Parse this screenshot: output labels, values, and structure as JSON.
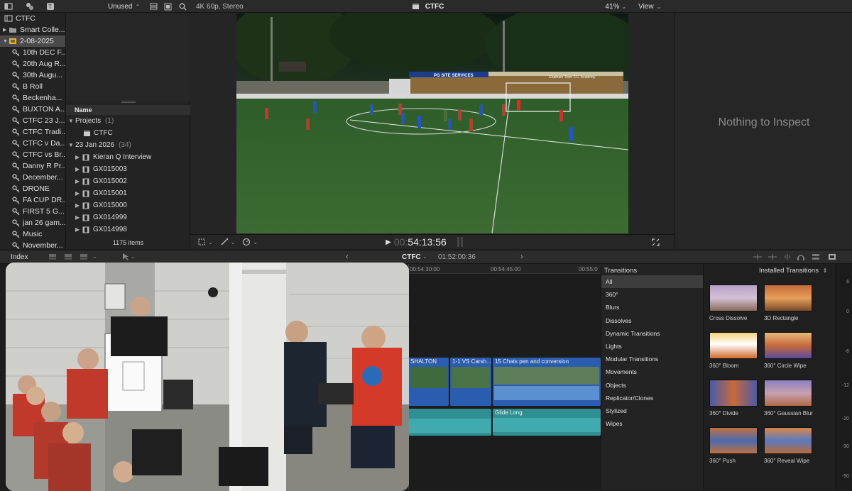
{
  "library": {
    "title": "CTFC",
    "items": [
      {
        "label": "Smart Colle...",
        "icon": "folder-icon",
        "kind": "folder"
      },
      {
        "label": "2-08-2025",
        "icon": "event-icon",
        "kind": "event",
        "selected": true
      },
      {
        "label": "10th DEC F...",
        "icon": "keyword-icon"
      },
      {
        "label": "20th Aug R...",
        "icon": "keyword-icon"
      },
      {
        "label": "30th Augu...",
        "icon": "keyword-icon"
      },
      {
        "label": "B Roll",
        "icon": "keyword-icon"
      },
      {
        "label": "Beckenha...",
        "icon": "keyword-icon"
      },
      {
        "label": "BUXTON A...",
        "icon": "keyword-icon"
      },
      {
        "label": "CTFC 23 J...",
        "icon": "keyword-icon"
      },
      {
        "label": "CTFC Tradi...",
        "icon": "keyword-icon"
      },
      {
        "label": "CTFC v Da...",
        "icon": "keyword-icon"
      },
      {
        "label": "CTFC vs Br...",
        "icon": "keyword-icon"
      },
      {
        "label": "Danny R Pr...",
        "icon": "keyword-icon"
      },
      {
        "label": "December...",
        "icon": "keyword-icon"
      },
      {
        "label": "DRONE",
        "icon": "keyword-icon"
      },
      {
        "label": "FA CUP DR...",
        "icon": "keyword-icon"
      },
      {
        "label": "FIRST 5 G...",
        "icon": "keyword-icon"
      },
      {
        "label": "jan 26 gam...",
        "icon": "keyword-icon"
      },
      {
        "label": "Music",
        "icon": "keyword-icon"
      },
      {
        "label": "November...",
        "icon": "keyword-icon"
      }
    ]
  },
  "browser": {
    "filter_label": "Unused",
    "column_header": "Name",
    "groups": [
      {
        "label": "Projects",
        "count": "(1)",
        "children": [
          {
            "label": "CTFC",
            "icon": "project-icon"
          }
        ]
      },
      {
        "label": "23 Jan 2026",
        "count": "(34)",
        "children": [
          {
            "label": "Kieran Q Interview",
            "icon": "film-icon"
          },
          {
            "label": "GX015003",
            "icon": "film-icon"
          },
          {
            "label": "GX015002",
            "icon": "film-icon"
          },
          {
            "label": "GX015001",
            "icon": "film-icon"
          },
          {
            "label": "GX015000",
            "icon": "film-icon"
          },
          {
            "label": "GX014999",
            "icon": "film-icon"
          },
          {
            "label": "GX014998",
            "icon": "film-icon"
          }
        ]
      }
    ],
    "footer": "1175 items"
  },
  "viewer": {
    "format": "4K 60p, Stereo",
    "project_name": "CTFC",
    "zoom": "41%",
    "view_label": "View",
    "timecode_dim": "00:",
    "timecode": "54:13:56",
    "banner_text": "PG SITE SERVICES",
    "academy_text": "Chatham Town F.C. Academy"
  },
  "inspector": {
    "empty_message": "Nothing to Inspect"
  },
  "timeline": {
    "index_label": "Index",
    "project_name": "CTFC",
    "duration": "01:52:00:36",
    "ruler_labels": [
      "00:54:30:00",
      "00:54:45:00",
      "00:55:0"
    ],
    "clips": [
      {
        "title": "SHALTON"
      },
      {
        "title": "1-1 VS Carsh..."
      },
      {
        "title": "15 Chats pen and conversion"
      }
    ],
    "audio_clip": "Glide Long"
  },
  "transitions": {
    "header": "Transitions",
    "installed": "Installed Transitions",
    "categories": [
      "All",
      "360°",
      "Blurs",
      "Dissolves",
      "Dynamic Transitions",
      "Lights",
      "Modular Transitions",
      "Movements",
      "Objects",
      "Replicator/Clones",
      "Stylized",
      "Wipes"
    ],
    "selected_category": "All",
    "tiles": [
      {
        "label": "Cross Dissolve"
      },
      {
        "label": "3D Rectangle"
      },
      {
        "label": "360° Bloom"
      },
      {
        "label": "360° Circle Wipe"
      },
      {
        "label": "360° Divide"
      },
      {
        "label": "360° Gaussian Blur"
      },
      {
        "label": "360° Push"
      },
      {
        "label": "360° Reveal Wipe"
      }
    ]
  },
  "meter": {
    "labels": [
      "6",
      "0",
      "-6",
      "-12",
      "-20",
      "-30",
      "-50"
    ]
  },
  "colors": {
    "accent": "#3a78c9",
    "audio": "#2f8f93",
    "selection": "#4a4a4a"
  }
}
